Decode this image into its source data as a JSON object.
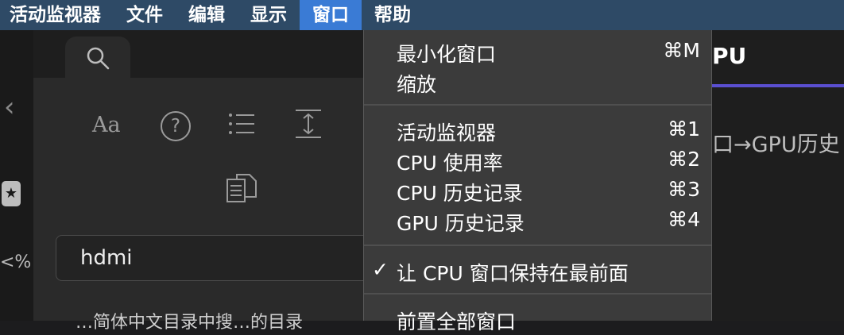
{
  "menubar": {
    "items": [
      {
        "label": "活动监视器"
      },
      {
        "label": "文件"
      },
      {
        "label": "编辑"
      },
      {
        "label": "显示"
      },
      {
        "label": "窗口",
        "active": true
      },
      {
        "label": "帮助"
      }
    ]
  },
  "window_menu": {
    "items": [
      {
        "label": "最小化窗口",
        "shortcut": "⌘M"
      },
      {
        "label": "缩放",
        "shortcut": ""
      },
      {
        "label": "活动监视器",
        "shortcut": "⌘1"
      },
      {
        "label": "CPU 使用率",
        "shortcut": "⌘2"
      },
      {
        "label": "CPU 历史记录",
        "shortcut": "⌘3"
      },
      {
        "label": "GPU 历史记录",
        "shortcut": "⌘4"
      },
      {
        "label": "让 CPU 窗口保持在最前面",
        "shortcut": "",
        "checked": true
      },
      {
        "label": "前置全部窗口",
        "shortcut": ""
      }
    ],
    "check_glyph": "✓"
  },
  "left_panel": {
    "search_value": "hdmi",
    "partial_text": "…简体中文目录中搜…的目录",
    "pct_text": "<%",
    "back_glyph": "‹",
    "aa_text": "Aa",
    "help_glyph": "?"
  },
  "right_window": {
    "title_partial": "PU",
    "crumb_partial": "口→GPU历史"
  },
  "colors": {
    "menubar_bg": "#2e4a66",
    "menu_active": "#3a7bd5",
    "menu_bg": "#3b3b3b",
    "accent_purple": "#5a4fd0"
  }
}
